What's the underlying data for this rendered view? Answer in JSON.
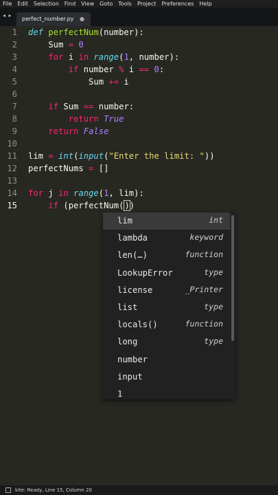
{
  "menu": [
    "File",
    "Edit",
    "Selection",
    "Find",
    "View",
    "Goto",
    "Tools",
    "Project",
    "Preferences",
    "Help"
  ],
  "tab": {
    "title": "perfect_number.py",
    "modified_indicator": "●",
    "nav": "◂ ▸"
  },
  "gutter": [
    "1",
    "2",
    "3",
    "4",
    "5",
    "6",
    "7",
    "8",
    "9",
    "10",
    "11",
    "12",
    "13",
    "14",
    "15"
  ],
  "current_line": "15",
  "code": [
    [
      {
        "t": "def",
        "c": "df"
      },
      {
        "t": " "
      },
      {
        "t": "perfectNum",
        "c": "fn"
      },
      {
        "t": "(number):"
      }
    ],
    [
      {
        "t": "    Sum "
      },
      {
        "t": "=",
        "c": "op"
      },
      {
        "t": " "
      },
      {
        "t": "0",
        "c": "num"
      }
    ],
    [
      {
        "t": "    "
      },
      {
        "t": "for",
        "c": "kw"
      },
      {
        "t": " i "
      },
      {
        "t": "in",
        "c": "kw"
      },
      {
        "t": " "
      },
      {
        "t": "range",
        "c": "bi"
      },
      {
        "t": "("
      },
      {
        "t": "1",
        "c": "num"
      },
      {
        "t": ", number):"
      }
    ],
    [
      {
        "t": "        "
      },
      {
        "t": "if",
        "c": "kw"
      },
      {
        "t": " number "
      },
      {
        "t": "%",
        "c": "op"
      },
      {
        "t": " i "
      },
      {
        "t": "==",
        "c": "op"
      },
      {
        "t": " "
      },
      {
        "t": "0",
        "c": "num"
      },
      {
        "t": ":"
      }
    ],
    [
      {
        "t": "            Sum "
      },
      {
        "t": "+=",
        "c": "op"
      },
      {
        "t": " i"
      }
    ],
    [
      {
        "t": ""
      }
    ],
    [
      {
        "t": "    "
      },
      {
        "t": "if",
        "c": "kw"
      },
      {
        "t": " Sum "
      },
      {
        "t": "==",
        "c": "op"
      },
      {
        "t": " number:"
      }
    ],
    [
      {
        "t": "        "
      },
      {
        "t": "return",
        "c": "kw"
      },
      {
        "t": " "
      },
      {
        "t": "True",
        "c": "cst"
      }
    ],
    [
      {
        "t": "    "
      },
      {
        "t": "return",
        "c": "kw"
      },
      {
        "t": " "
      },
      {
        "t": "False",
        "c": "cst"
      }
    ],
    [
      {
        "t": ""
      }
    ],
    [
      {
        "t": "lim "
      },
      {
        "t": "=",
        "c": "op"
      },
      {
        "t": " "
      },
      {
        "t": "int",
        "c": "bi"
      },
      {
        "t": "("
      },
      {
        "t": "input",
        "c": "bi"
      },
      {
        "t": "("
      },
      {
        "t": "\"Enter the limit: \"",
        "c": "str"
      },
      {
        "t": "))"
      }
    ],
    [
      {
        "t": "perfectNums "
      },
      {
        "t": "=",
        "c": "op"
      },
      {
        "t": " []"
      }
    ],
    [
      {
        "t": ""
      }
    ],
    [
      {
        "t": "for",
        "c": "kw"
      },
      {
        "t": " j "
      },
      {
        "t": "in",
        "c": "kw"
      },
      {
        "t": " "
      },
      {
        "t": "range",
        "c": "bi"
      },
      {
        "t": "("
      },
      {
        "t": "1",
        "c": "num"
      },
      {
        "t": ", lim):"
      }
    ],
    [
      {
        "t": "    "
      },
      {
        "t": "if",
        "c": "kw"
      },
      {
        "t": " (perfectNum("
      },
      {
        "t": "CURSOR"
      },
      {
        "t": ")",
        "c": "hl"
      },
      {
        "t": ")"
      }
    ]
  ],
  "autocomplete": [
    {
      "name": "lim",
      "type": "int",
      "selected": true
    },
    {
      "name": "lambda",
      "type": "keyword"
    },
    {
      "name": "len(…)",
      "type": "function"
    },
    {
      "name": "LookupError",
      "type": "type"
    },
    {
      "name": "license",
      "type": "_Printer"
    },
    {
      "name": "list",
      "type": "type"
    },
    {
      "name": "locals()",
      "type": "function"
    },
    {
      "name": "long",
      "type": "type"
    },
    {
      "name": "number",
      "type": ""
    },
    {
      "name": "input",
      "type": ""
    },
    {
      "name": "1",
      "type": ""
    }
  ],
  "status": {
    "text": "kite: Ready, Line 15, Column 20"
  },
  "colors": {
    "background": "#272822",
    "keyword": "#f92672",
    "function": "#a6e22e",
    "builtin": "#66d9ef",
    "number": "#ae81ff",
    "string": "#e6db74"
  }
}
